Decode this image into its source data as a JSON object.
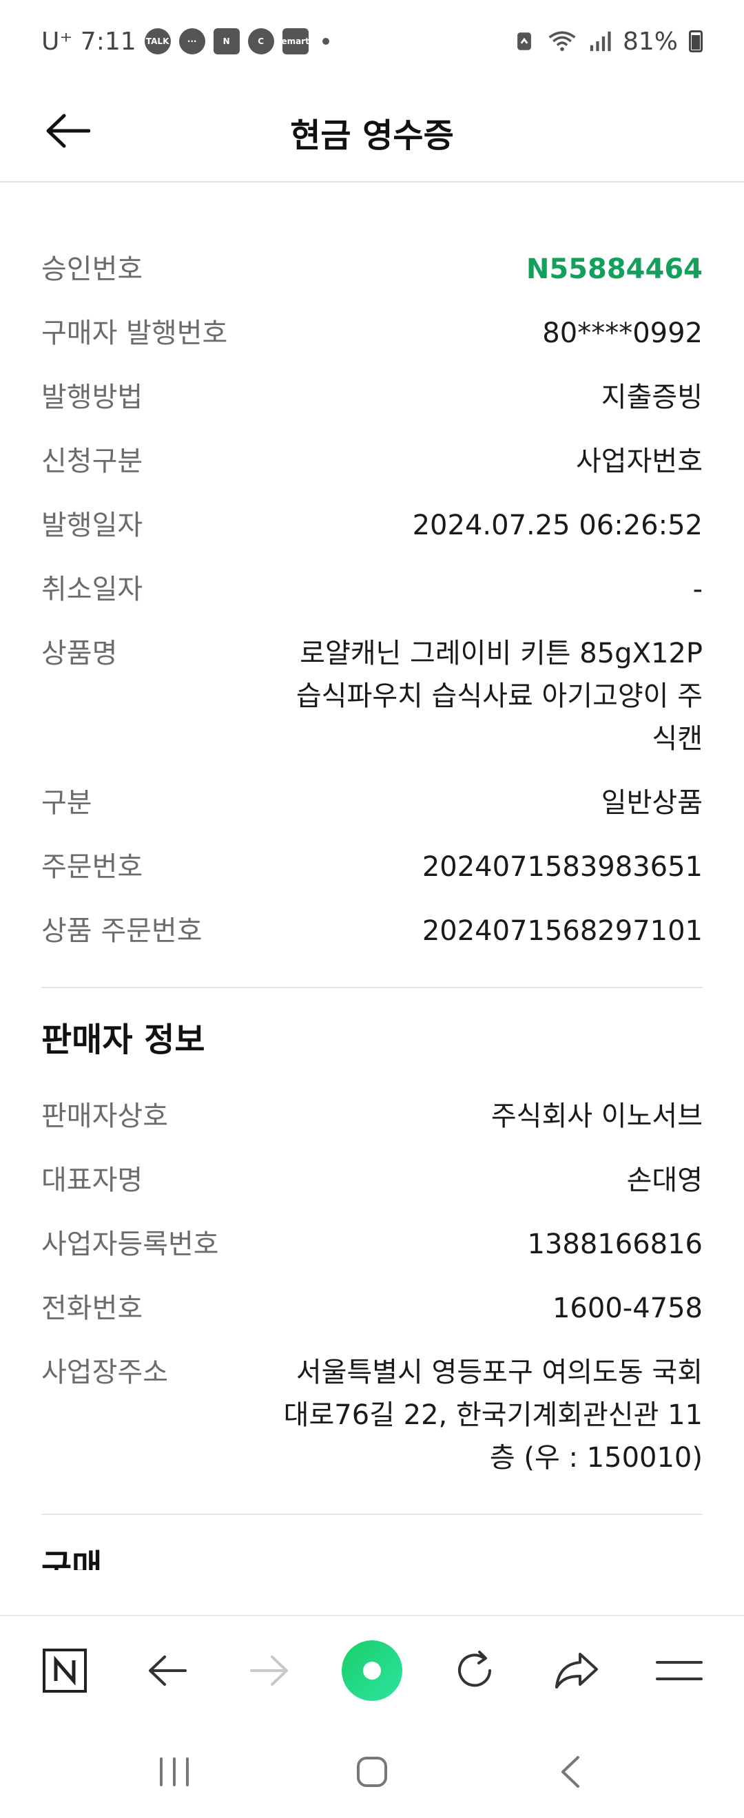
{
  "status": {
    "carrier": "U⁺ 7:11",
    "battery": "81%",
    "notifications": [
      "TALK",
      "···",
      "N",
      "C",
      "emart"
    ]
  },
  "header": {
    "title": "현금 영수증"
  },
  "receipt": [
    {
      "label": "승인번호",
      "value": "N55884464",
      "highlight": true
    },
    {
      "label": "구매자 발행번호",
      "value": "80****0992"
    },
    {
      "label": "발행방법",
      "value": "지출증빙"
    },
    {
      "label": "신청구분",
      "value": "사업자번호"
    },
    {
      "label": "발행일자",
      "value": "2024.07.25 06:26:52"
    },
    {
      "label": "취소일자",
      "value": "-"
    },
    {
      "label": "상품명",
      "value": "로얄캐닌 그레이비 키튼 85gX12P 습식파우치 습식사료 아기고양이 주식캔"
    },
    {
      "label": "구분",
      "value": "일반상품"
    },
    {
      "label": "주문번호",
      "value": "2024071583983651"
    },
    {
      "label": "상품 주문번호",
      "value": "2024071568297101"
    }
  ],
  "seller": {
    "title": "판매자 정보",
    "rows": [
      {
        "label": "판매자상호",
        "value": "주식회사 이노서브"
      },
      {
        "label": "대표자명",
        "value": "손대영"
      },
      {
        "label": "사업자등록번호",
        "value": "1388166816"
      },
      {
        "label": "전화번호",
        "value": "1600-4758"
      },
      {
        "label": "사업장주소",
        "value": "서울특별시 영등포구 여의도동 국회대로76길 22, 한국기계회관신관 11층 (우 : 150010)"
      }
    ]
  },
  "next_section": {
    "title": "구매"
  },
  "colors": {
    "accent": "#12a05a",
    "green_button": "#1ed67a"
  },
  "toolbar": {
    "icons": [
      "naver-home-icon",
      "back-arrow-icon",
      "forward-arrow-icon",
      "green-dot-icon",
      "refresh-icon",
      "share-icon",
      "menu-icon"
    ]
  }
}
